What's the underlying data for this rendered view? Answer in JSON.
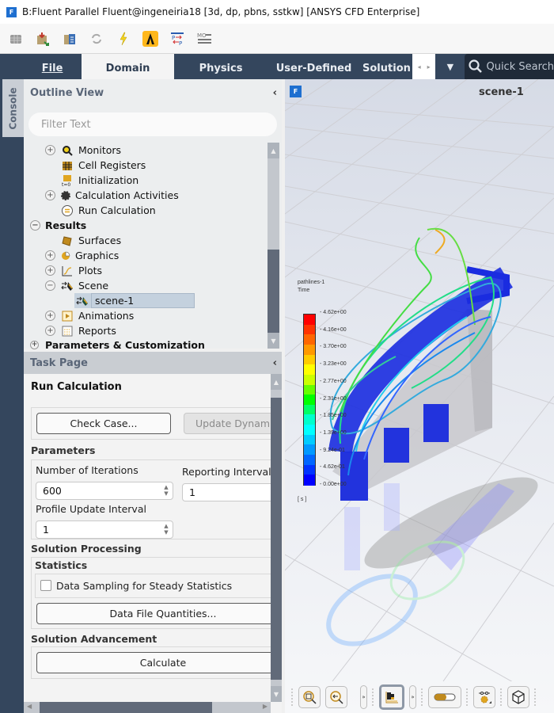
{
  "window": {
    "title": "B:Fluent Parallel Fluent@ingeneiria18  [3d, dp, pbns, sstkw] [ANSYS CFD Enterprise]",
    "app_icon": "F"
  },
  "toolbar": {
    "icons": [
      "mesh-cube-icon",
      "read-case-icon",
      "calculator-icon",
      "refresh-icon",
      "lightning-icon",
      "ansys-logo-icon",
      "parameter-transfer-icon",
      "mo-list-icon"
    ]
  },
  "ribbon": {
    "tabs": [
      {
        "label": "File",
        "active": false
      },
      {
        "label": "Domain",
        "active": true
      },
      {
        "label": "Physics",
        "active": false
      },
      {
        "label": "User-Defined",
        "active": false
      },
      {
        "label": "Solution",
        "active": false
      }
    ],
    "quick_search_placeholder": "Quick Search"
  },
  "console_tab": "Console",
  "outline": {
    "title": "Outline View",
    "filter_placeholder": "Filter Text",
    "items": [
      {
        "label": "Monitors",
        "expander": "+",
        "icon": "🔍",
        "level": 2
      },
      {
        "label": "Cell Registers",
        "expander": "",
        "icon": "▦",
        "level": 2
      },
      {
        "label": "Initialization",
        "expander": "",
        "icon": "▣",
        "level": 2
      },
      {
        "label": "Calculation Activities",
        "expander": "+",
        "icon": "✹",
        "level": 2
      },
      {
        "label": "Run Calculation",
        "expander": "",
        "icon": "⊜",
        "level": 2
      },
      {
        "label": "Results",
        "expander": "−",
        "icon": "",
        "level": 1
      },
      {
        "label": "Surfaces",
        "expander": "",
        "icon": "◆",
        "level": 2
      },
      {
        "label": "Graphics",
        "expander": "+",
        "icon": "◕",
        "level": 2
      },
      {
        "label": "Plots",
        "expander": "+",
        "icon": "∫",
        "level": 2
      },
      {
        "label": "Scene",
        "expander": "−",
        "icon": "⇉",
        "level": 2
      },
      {
        "label": "scene-1",
        "expander": "",
        "icon": "⇉",
        "level": 3,
        "selected": true
      },
      {
        "label": "Animations",
        "expander": "+",
        "icon": "▶",
        "level": 2
      },
      {
        "label": "Reports",
        "expander": "+",
        "icon": "▤",
        "level": 2
      },
      {
        "label": "Parameters & Customization",
        "expander": "+",
        "icon": "",
        "level": 1
      }
    ]
  },
  "task_page": {
    "title": "Task Page",
    "heading": "Run Calculation",
    "check_case_label": "Check Case...",
    "update_dynamic_label": "Update Dynamic",
    "parameters_title": "Parameters",
    "num_iterations_label": "Number of Iterations",
    "num_iterations_value": "600",
    "reporting_interval_label": "Reporting Interval",
    "reporting_interval_value": "1",
    "profile_update_label": "Profile Update Interval",
    "profile_update_value": "1",
    "solution_processing_title": "Solution Processing",
    "statistics_title": "Statistics",
    "data_sampling_label": "Data Sampling for Steady Statistics",
    "data_sampling_checked": false,
    "data_file_quantities_label": "Data File Quantities...",
    "solution_advancement_title": "Solution Advancement",
    "calculate_label": "Calculate"
  },
  "viewport": {
    "title": "scene-1",
    "logo": "F",
    "colorbar": {
      "name": "pathlines-1",
      "quantity": "Time",
      "unit": "[ s ]",
      "ticks": [
        "4.62e+00",
        "4.16e+00",
        "3.70e+00",
        "3.23e+00",
        "2.77e+00",
        "2.31e+00",
        "1.85e+00",
        "1.39e+00",
        "9.24e-01",
        "4.62e-01",
        "0.00e+00"
      ],
      "colors": [
        "#ff0000",
        "#ff3300",
        "#ff6600",
        "#ff9900",
        "#ffcc00",
        "#ffff00",
        "#ccff00",
        "#66ff00",
        "#00ff00",
        "#00ff66",
        "#00ffcc",
        "#00ffff",
        "#00ccff",
        "#0099ff",
        "#0066ff",
        "#0033ff",
        "#0000ff"
      ]
    },
    "toolbar_icons": [
      "zoom-to-fit-icon",
      "zoom-previous-icon",
      "more-icon",
      "colormap-icon",
      "more-icon",
      "toggle-icon",
      "settings-icon",
      "view-cube-icon"
    ]
  }
}
